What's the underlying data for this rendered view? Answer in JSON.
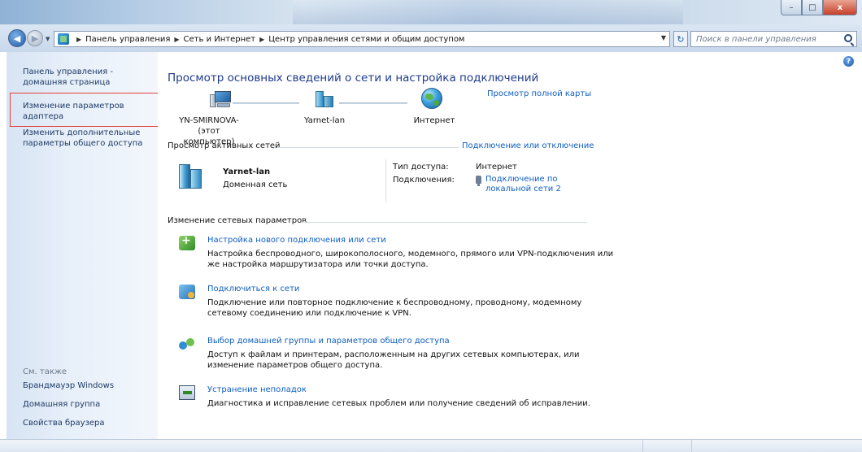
{
  "window": {
    "minimize_glyph": "–",
    "maximize_glyph": "□",
    "close_glyph": "x"
  },
  "address_bar": {
    "crumbs": [
      "Панель управления",
      "Сеть и Интернет",
      "Центр управления сетями и общим доступом"
    ],
    "search_placeholder": "Поиск в панели управления"
  },
  "sidebar": {
    "home": "Панель управления - домашняя страница",
    "adapter": "Изменение параметров адаптера",
    "sharing": "Изменить дополнительные параметры общего доступа",
    "see_also": "См. также",
    "firewall": "Брандмауэр Windows",
    "homegroup": "Домашняя группа",
    "browser": "Свойства браузера"
  },
  "main": {
    "title": "Просмотр основных сведений о сети и настройка подключений",
    "full_map": "Просмотр полной карты",
    "map": {
      "pc_name": "YN-SMIRNOVA-",
      "pc_note": "(этот компьютер)",
      "lan_name": "Yarnet-lan",
      "internet": "Интернет"
    },
    "active_header": "Просмотр активных сетей",
    "connect_disconnect": "Подключение или отключение",
    "network": {
      "name": "Yarnet-lan",
      "type": "Доменная сеть",
      "access_label": "Тип доступа:",
      "access_value": "Интернет",
      "connections_label": "Подключения:",
      "connection_link": "Подключение по локальной сети 2"
    },
    "change_header": "Изменение сетевых параметров",
    "tasks": [
      {
        "link": "Настройка нового подключения или сети",
        "desc": "Настройка беспроводного, широкополосного, модемного, прямого или VPN-подключения или же настройка маршрутизатора или точки доступа."
      },
      {
        "link": "Подключиться к сети",
        "desc": "Подключение или повторное подключение к беспроводному, проводному, модемному сетевому соединению или подключение к VPN."
      },
      {
        "link": "Выбор домашней группы и параметров общего доступа",
        "desc": "Доступ к файлам и принтерам, расположенным на других сетевых компьютерах, или изменение параметров общего доступа."
      },
      {
        "link": "Устранение неполадок",
        "desc": "Диагностика и исправление сетевых проблем или получение сведений об исправлении."
      }
    ]
  }
}
